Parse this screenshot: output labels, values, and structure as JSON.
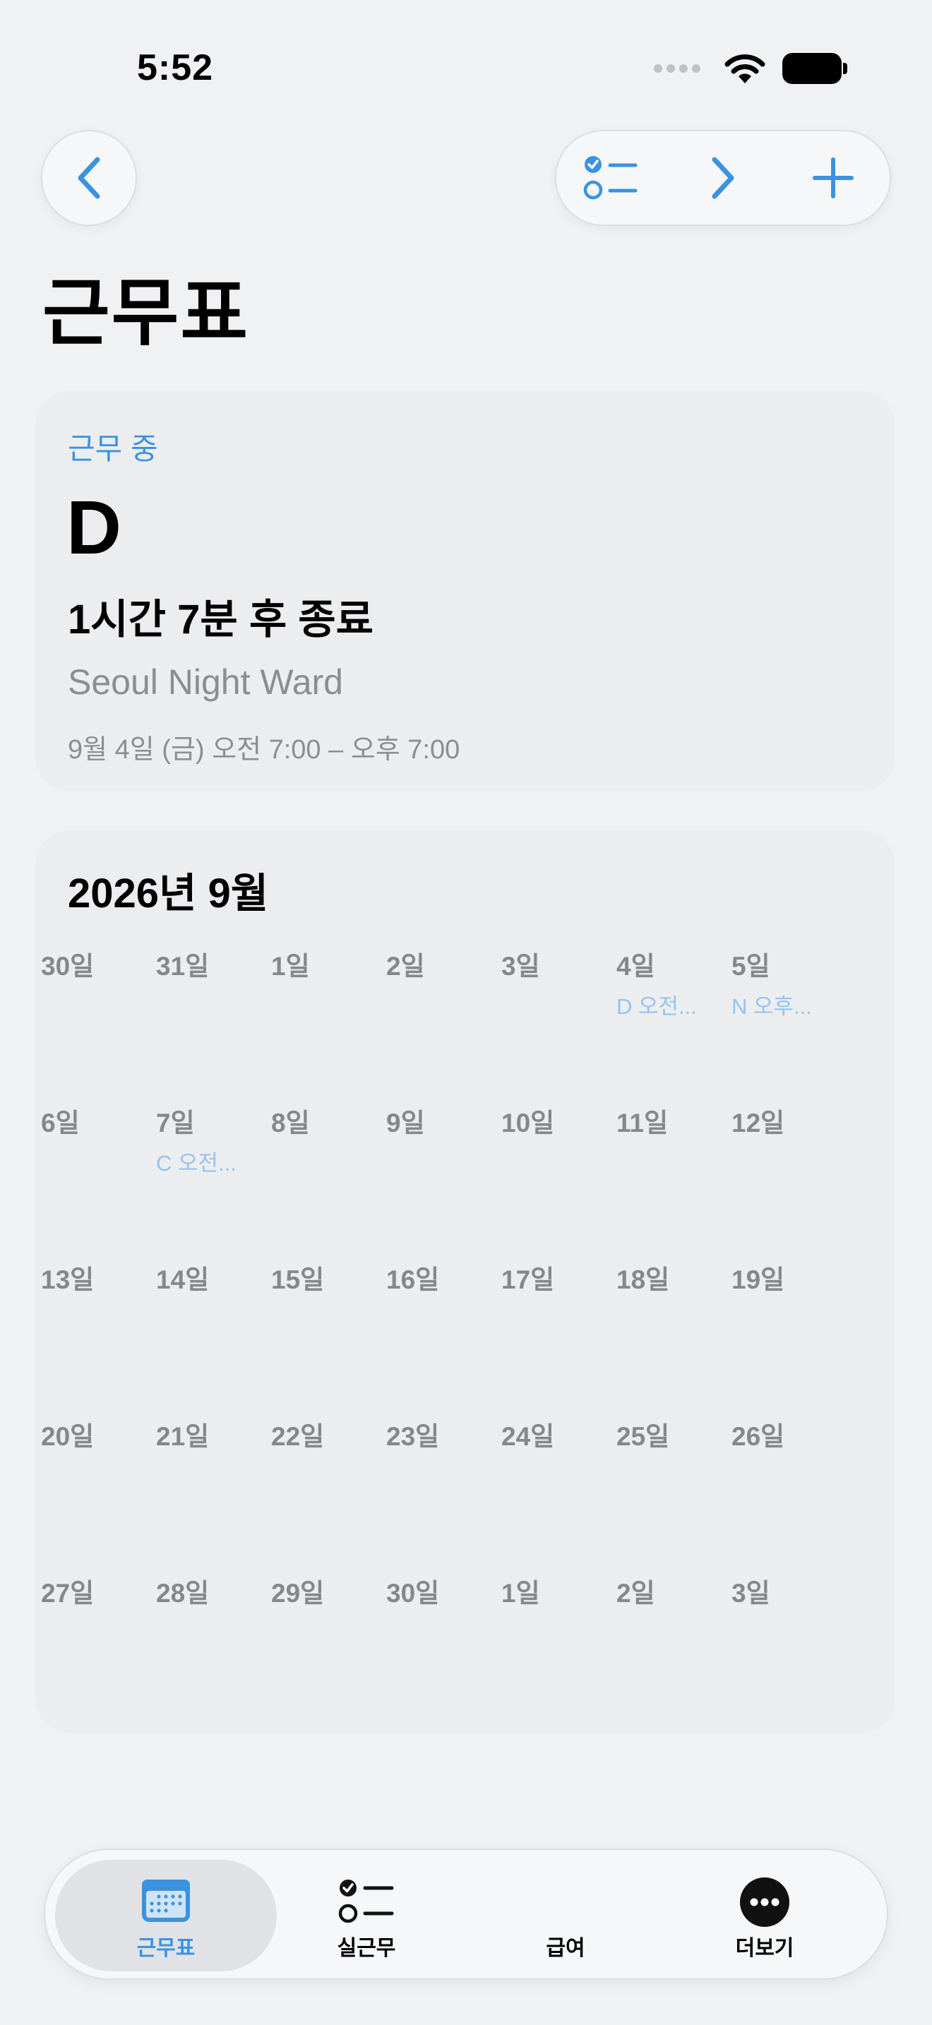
{
  "status_bar": {
    "time": "5:52"
  },
  "header": {
    "title": "근무표"
  },
  "current_shift": {
    "status": "근무 중",
    "code": "D",
    "remaining": "1시간 7분 후 종료",
    "ward": "Seoul Night Ward",
    "time_range": "9월 4일 (금) 오전 7:00 – 오후 7:00"
  },
  "calendar": {
    "title": "2026년 9월",
    "weeks": [
      [
        {
          "day": "30일"
        },
        {
          "day": "31일"
        },
        {
          "day": "1일"
        },
        {
          "day": "2일"
        },
        {
          "day": "3일"
        },
        {
          "day": "4일",
          "event": "D 오전..."
        },
        {
          "day": "5일",
          "event": "N 오후..."
        }
      ],
      [
        {
          "day": "6일"
        },
        {
          "day": "7일",
          "event": "C 오전..."
        },
        {
          "day": "8일"
        },
        {
          "day": "9일"
        },
        {
          "day": "10일"
        },
        {
          "day": "11일"
        },
        {
          "day": "12일"
        }
      ],
      [
        {
          "day": "13일"
        },
        {
          "day": "14일"
        },
        {
          "day": "15일"
        },
        {
          "day": "16일"
        },
        {
          "day": "17일"
        },
        {
          "day": "18일"
        },
        {
          "day": "19일"
        }
      ],
      [
        {
          "day": "20일"
        },
        {
          "day": "21일"
        },
        {
          "day": "22일"
        },
        {
          "day": "23일"
        },
        {
          "day": "24일"
        },
        {
          "day": "25일"
        },
        {
          "day": "26일"
        }
      ],
      [
        {
          "day": "27일"
        },
        {
          "day": "28일"
        },
        {
          "day": "29일"
        },
        {
          "day": "30일"
        },
        {
          "day": "1일"
        },
        {
          "day": "2일"
        },
        {
          "day": "3일"
        }
      ]
    ]
  },
  "tabbar": {
    "tabs": [
      {
        "label": "근무표",
        "icon": "calendar-icon",
        "active": true
      },
      {
        "label": "실근무",
        "icon": "checklist-icon",
        "active": false
      },
      {
        "label": "급여",
        "icon": "",
        "active": false
      },
      {
        "label": "더보기",
        "icon": "more-icon",
        "active": false
      }
    ]
  },
  "colors": {
    "accent": "#3b93e0",
    "event_text": "#95c3ee",
    "muted_text": "#8b8d91",
    "background": "#eff1f3",
    "card": "#ecedef"
  }
}
